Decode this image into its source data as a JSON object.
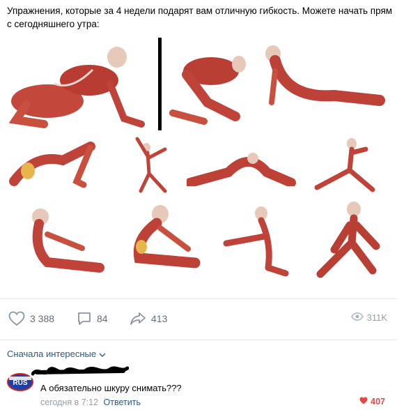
{
  "post": {
    "text": "Упражнения, которые за 4 недели подарят вам отличную гибкость. Можете начать прям с сегодняшнего утра:"
  },
  "actions": {
    "likes": "3 388",
    "comments": "84",
    "shares": "413",
    "views": "311K",
    "icons": [
      "heart-icon",
      "comment-icon",
      "share-icon",
      "eye-icon"
    ]
  },
  "comments_section": {
    "sort_label": "Сначала интересные",
    "comment": {
      "avatar_text": "RUS",
      "text": "А обязательно шкуру снимать???",
      "time": "сегодня в 7:12",
      "reply_label": "Ответить",
      "likes": "407"
    }
  },
  "colors": {
    "link": "#2a5885",
    "muted": "#939ea8",
    "like_red": "#e64646",
    "muscle": "#c0433a"
  }
}
